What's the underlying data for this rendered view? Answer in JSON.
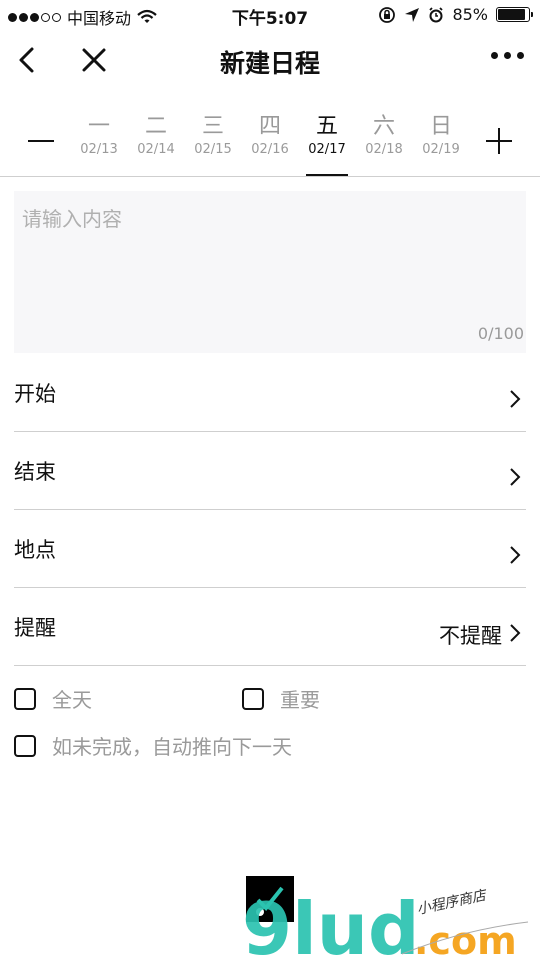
{
  "status_bar": {
    "carrier": "中国移动",
    "time": "下午5:07",
    "battery_text": "85%",
    "battery_level": 0.85
  },
  "nav": {
    "title": "新建日程"
  },
  "week": {
    "days": [
      {
        "weekday": "一",
        "date": "02/13"
      },
      {
        "weekday": "二",
        "date": "02/14"
      },
      {
        "weekday": "三",
        "date": "02/15"
      },
      {
        "weekday": "四",
        "date": "02/16"
      },
      {
        "weekday": "五",
        "date": "02/17",
        "selected": true
      },
      {
        "weekday": "六",
        "date": "02/18"
      },
      {
        "weekday": "日",
        "date": "02/19"
      }
    ]
  },
  "content": {
    "placeholder": "请输入内容",
    "counter": "0/100"
  },
  "rows": {
    "start": {
      "label": "开始"
    },
    "end": {
      "label": "结束"
    },
    "location": {
      "label": "地点"
    },
    "reminder": {
      "label": "提醒",
      "value": "不提醒"
    }
  },
  "checks": {
    "all_day": "全天",
    "important": "重要",
    "auto_carry": "如未完成，自动推向下一天"
  },
  "watermark": {
    "brand": "9lud",
    "domain": ".com",
    "tagline": "小程序商店"
  },
  "colors": {
    "text": "#111111",
    "muted": "#9a9a9a",
    "divider": "#cfcfcf",
    "input_bg": "#f7f7f9",
    "watermark_teal": "#2bc3b0",
    "watermark_orange": "#f5a623"
  }
}
